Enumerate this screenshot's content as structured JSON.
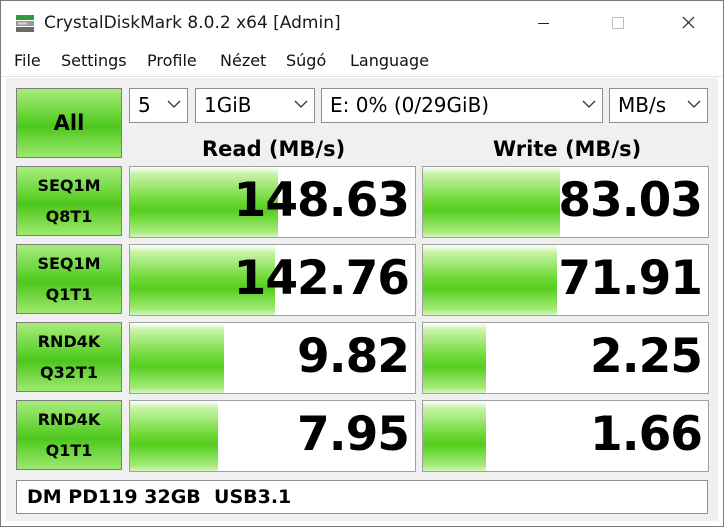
{
  "window": {
    "title": "CrystalDiskMark 8.0.2 x64 [Admin]"
  },
  "menu": [
    "File",
    "Settings",
    "Profile",
    "Nézet",
    "Súgó",
    "Language"
  ],
  "controls": {
    "all_label": "All",
    "count": "5",
    "size": "1GiB",
    "drive": "E: 0% (0/29GiB)",
    "unit": "MB/s"
  },
  "headers": {
    "read": "Read (MB/s)",
    "write": "Write (MB/s)"
  },
  "tests": [
    {
      "line1": "SEQ1M",
      "line2": "Q8T1",
      "read": "148.63",
      "write": "83.03",
      "read_fill": 0.52,
      "write_fill": 0.48
    },
    {
      "line1": "SEQ1M",
      "line2": "Q1T1",
      "read": "142.76",
      "write": "71.91",
      "read_fill": 0.51,
      "write_fill": 0.47
    },
    {
      "line1": "RND4K",
      "line2": "Q32T1",
      "read": "9.82",
      "write": "2.25",
      "read_fill": 0.33,
      "write_fill": 0.22
    },
    {
      "line1": "RND4K",
      "line2": "Q1T1",
      "read": "7.95",
      "write": "1.66",
      "read_fill": 0.31,
      "write_fill": 0.22
    }
  ],
  "comment": "DM PD119 32GB  USB3.1",
  "colors": {
    "accent_green": "#5dd02c",
    "bar_green": "#55ce1f"
  }
}
